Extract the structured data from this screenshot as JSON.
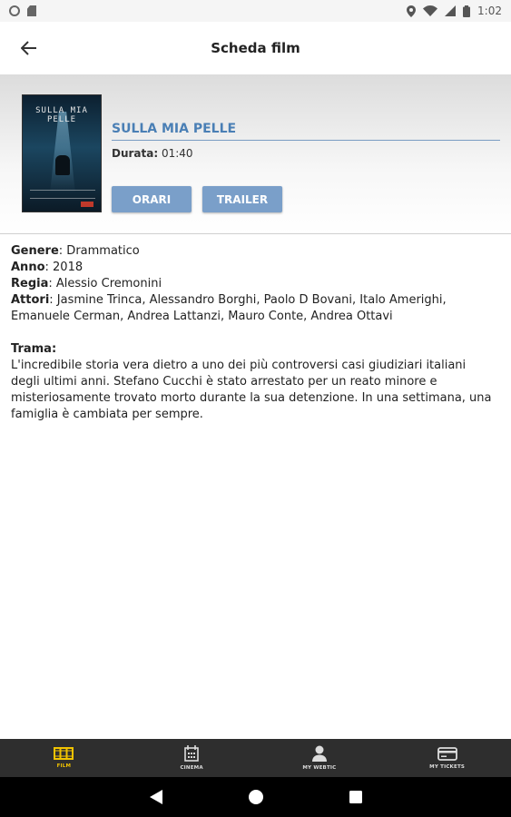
{
  "status_bar": {
    "time": "1:02"
  },
  "app_bar": {
    "title": "Scheda film"
  },
  "film": {
    "title": "SULLA MIA PELLE",
    "poster_text": "SULLA MIA PELLE",
    "duration_label": "Durata:",
    "duration_value": "01:40",
    "buttons": {
      "orari": "ORARI",
      "trailer": "TRAILER"
    }
  },
  "details": {
    "genre_label": "Genere",
    "genre_value": ": Drammatico",
    "year_label": "Anno",
    "year_value": ": 2018",
    "director_label": "Regia",
    "director_value": ": Alessio Cremonini",
    "actors_label": "Attori",
    "actors_value": ": Jasmine Trinca, Alessandro Borghi, Paolo D Bovani, Italo Amerighi, Emanuele Cerman, Andrea Lattanzi, Mauro Conte, Andrea Ottavi",
    "plot_label": "Trama:",
    "plot_text": "L'incredibile storia vera dietro a uno dei più controversi casi giudiziari italiani degli ultimi anni. Stefano Cucchi è stato arrestato per un reato minore e misteriosamente trovato morto durante la sua detenzione. In una settimana, una famiglia è cambiata per sempre."
  },
  "bottom_nav": {
    "active_color": "#f2c300",
    "items": [
      {
        "label": "FILM",
        "icon": "film-icon"
      },
      {
        "label": "CINEMA",
        "icon": "cinema-icon"
      },
      {
        "label": "MY WEBTIC",
        "icon": "user-icon"
      },
      {
        "label": "MY TICKETS",
        "icon": "ticket-card-icon"
      }
    ]
  },
  "colors": {
    "accent": "#4a7fb5",
    "button": "#7a9fc9",
    "nav_bg": "#2e2e2e"
  }
}
